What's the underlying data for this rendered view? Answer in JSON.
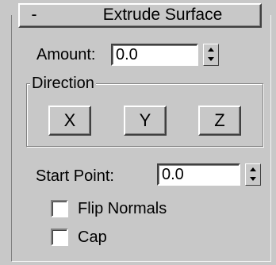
{
  "rollout": {
    "collapse_label": "-",
    "title": "Extrude Surface"
  },
  "amount": {
    "label": "Amount:",
    "value": "0.0"
  },
  "direction": {
    "title": "Direction",
    "buttons": [
      "X",
      "Y",
      "Z"
    ]
  },
  "start_point": {
    "label": "Start Point:",
    "value": "0.0"
  },
  "options": {
    "flip_normals": {
      "label": "Flip Normals",
      "checked": false
    },
    "cap": {
      "label": "Cap",
      "checked": false
    }
  },
  "colors": {
    "panel_bg": "#c8c8c8",
    "field_bg": "#ffffff"
  }
}
